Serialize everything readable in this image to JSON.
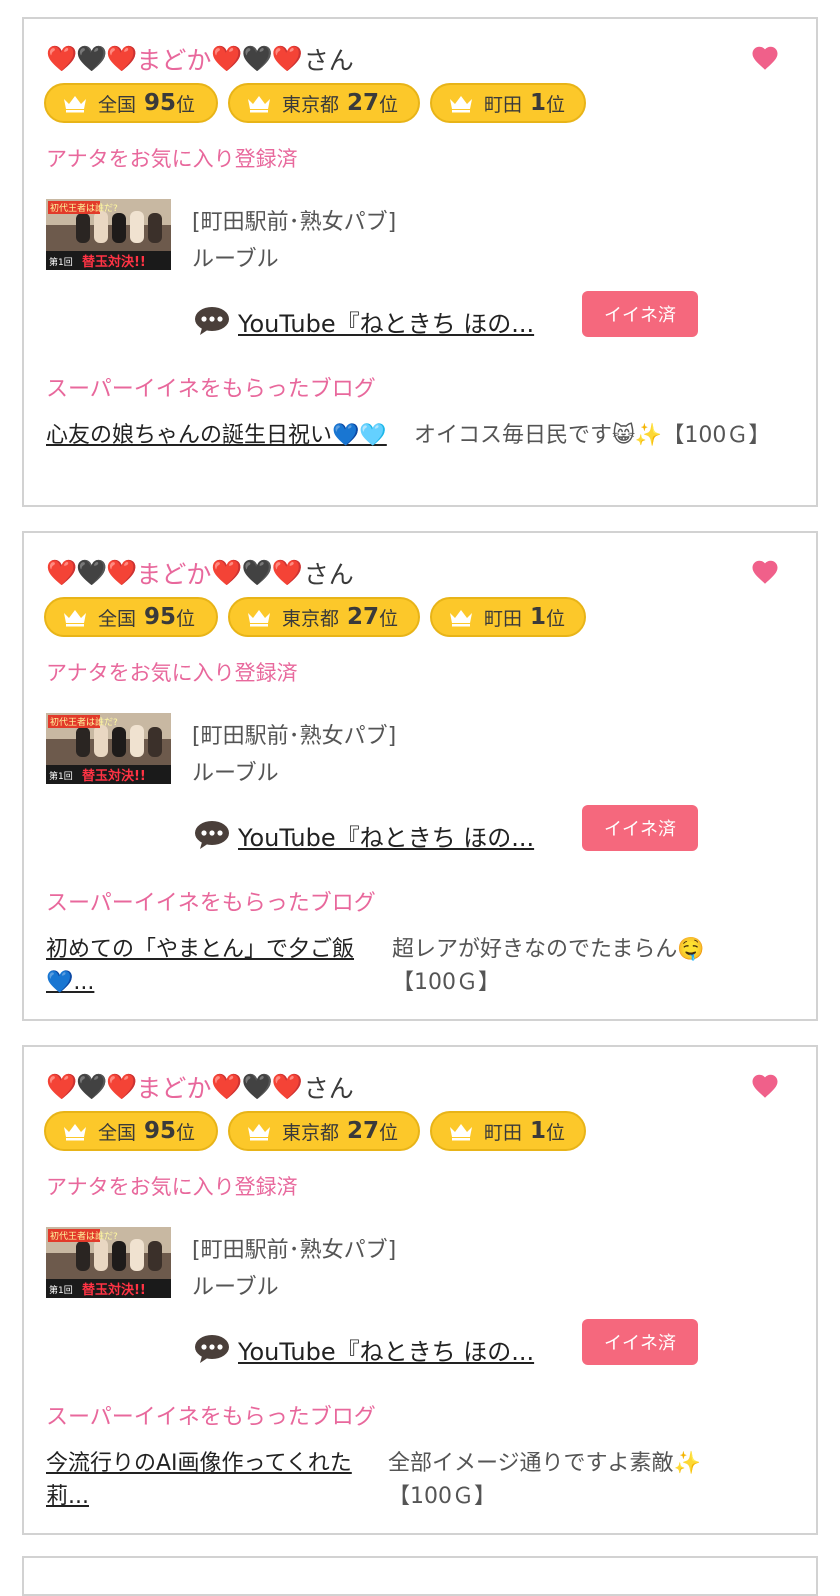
{
  "cards": [
    {
      "user": {
        "prefix": "❤️🖤❤️",
        "name": "まどか",
        "suffix": "❤️🖤❤️",
        "honorific": "さん"
      },
      "rankings": [
        {
          "area": "全国",
          "rank": "95",
          "suffix": "位"
        },
        {
          "area": "東京都",
          "rank": "27",
          "suffix": "位"
        },
        {
          "area": "町田",
          "rank": "1",
          "suffix": "位"
        }
      ],
      "favorite_status": "アナタをお気に入り登録済",
      "shop": {
        "category": "[町田駅前･熟女パブ]",
        "name": "ルーブル"
      },
      "youtube_link": "YouTube『ねときち ほの...",
      "iine_label": "イイネ済",
      "super_title": "スーパーイイネをもらったブログ",
      "blog_title": "心友の娘ちゃんの誕生日祝い💙🩵",
      "blog_comment": "オイコス毎日民です😸✨【100Ｇ】"
    },
    {
      "user": {
        "prefix": "❤️🖤❤️",
        "name": "まどか",
        "suffix": "❤️🖤❤️",
        "honorific": "さん"
      },
      "rankings": [
        {
          "area": "全国",
          "rank": "95",
          "suffix": "位"
        },
        {
          "area": "東京都",
          "rank": "27",
          "suffix": "位"
        },
        {
          "area": "町田",
          "rank": "1",
          "suffix": "位"
        }
      ],
      "favorite_status": "アナタをお気に入り登録済",
      "shop": {
        "category": "[町田駅前･熟女パブ]",
        "name": "ルーブル"
      },
      "youtube_link": "YouTube『ねときち ほの...",
      "iine_label": "イイネ済",
      "super_title": "スーパーイイネをもらったブログ",
      "blog_title": "初めての「やまとん」で夕ご飯💙...",
      "blog_comment": "超レアが好きなのでたまらん🤤【100Ｇ】"
    },
    {
      "user": {
        "prefix": "❤️🖤❤️",
        "name": "まどか",
        "suffix": "❤️🖤❤️",
        "honorific": "さん"
      },
      "rankings": [
        {
          "area": "全国",
          "rank": "95",
          "suffix": "位"
        },
        {
          "area": "東京都",
          "rank": "27",
          "suffix": "位"
        },
        {
          "area": "町田",
          "rank": "1",
          "suffix": "位"
        }
      ],
      "favorite_status": "アナタをお気に入り登録済",
      "shop": {
        "category": "[町田駅前･熟女パブ]",
        "name": "ルーブル"
      },
      "youtube_link": "YouTube『ねときち ほの...",
      "iine_label": "イイネ済",
      "super_title": "スーパーイイネをもらったブログ",
      "blog_title": "今流行りのAI画像作ってくれた莉...",
      "blog_comment": "全部イメージ通りですよ素敵✨【100Ｇ】"
    }
  ],
  "thumbnail": {
    "top_text": "初代王者は誰だ?",
    "episode": "第1回",
    "banner": "替玉対決!!"
  },
  "colors": {
    "pink": "#e8689c",
    "badge": "#fcc82a",
    "iine": "#f5687d"
  }
}
